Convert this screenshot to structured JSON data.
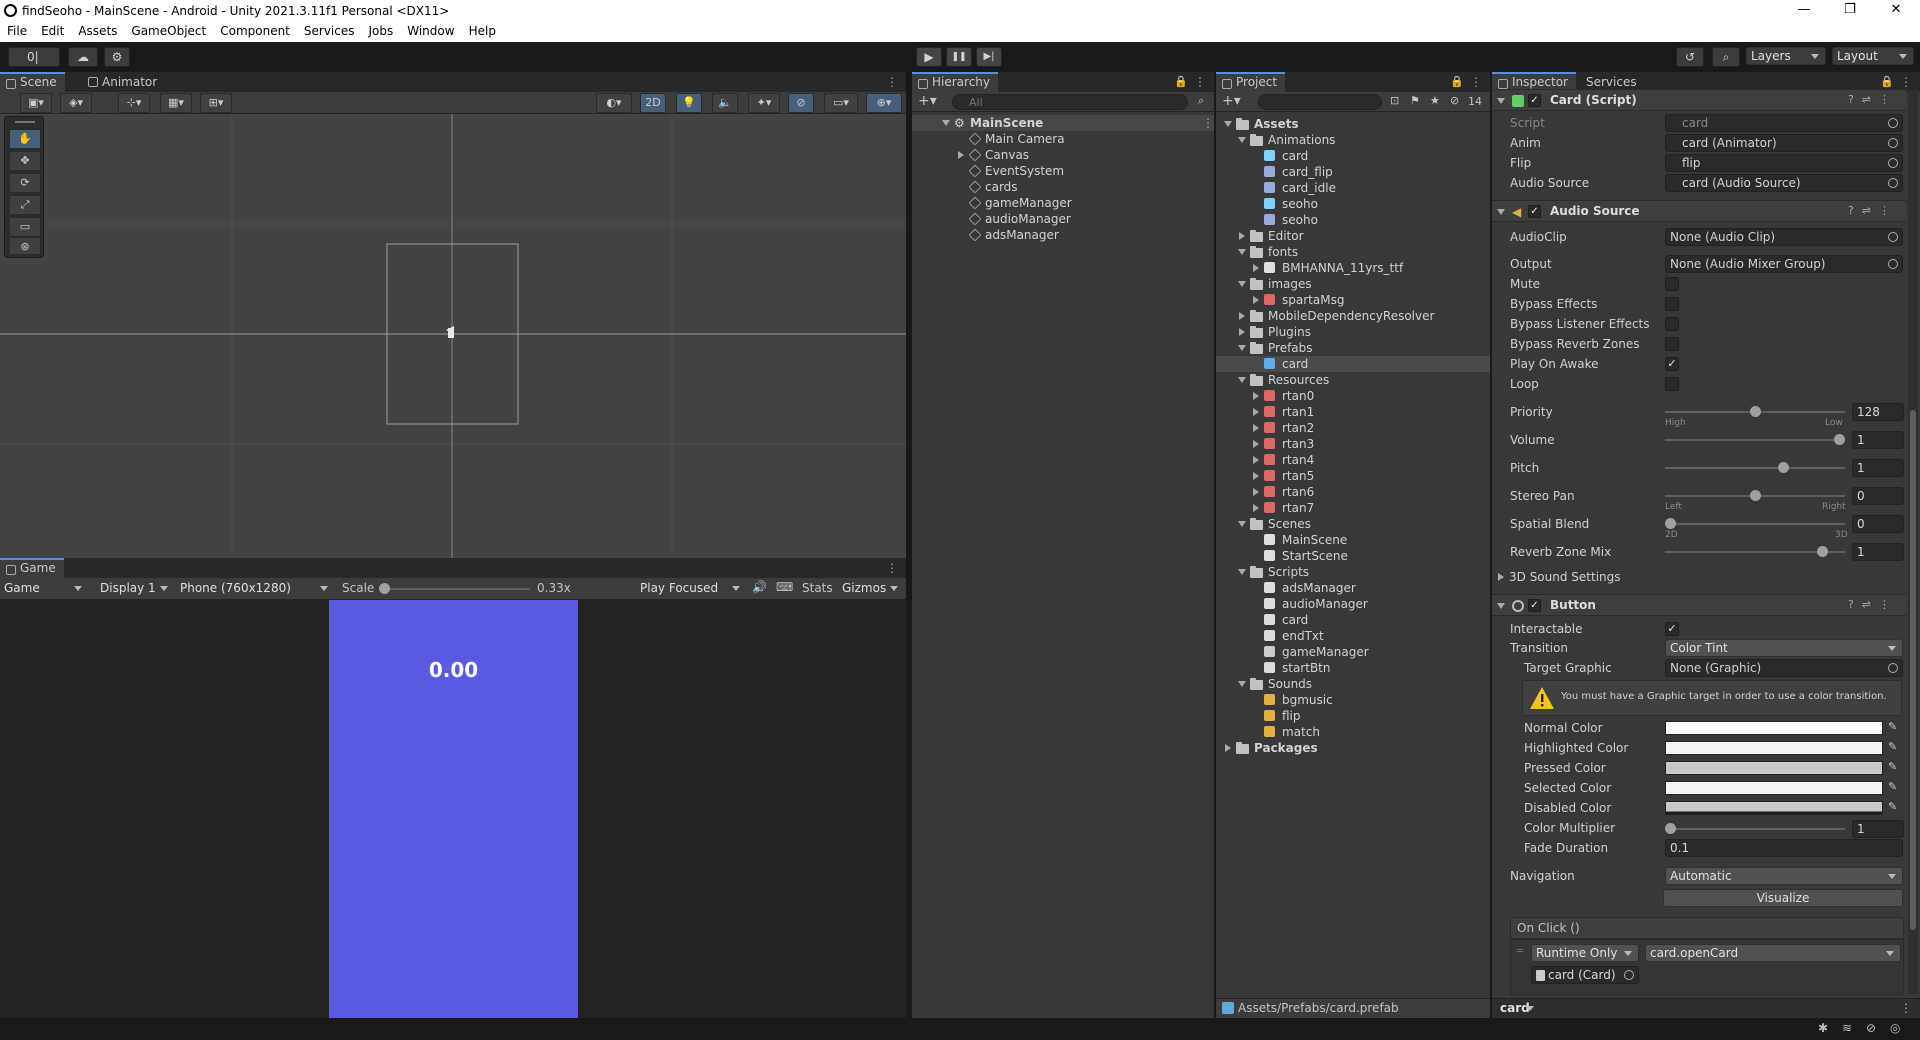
{
  "window": {
    "title": "findSeoho - MainScene - Android - Unity 2021.3.11f1 Personal <DX11>",
    "minimize": "—",
    "maximize": "❐",
    "close": "✕"
  },
  "menu": [
    "File",
    "Edit",
    "Assets",
    "GameObject",
    "Component",
    "Services",
    "Jobs",
    "Window",
    "Help"
  ],
  "toolbar": {
    "account_value": "0|",
    "play": "▶",
    "pause": "❚❚",
    "step": "▶|",
    "layers": "Layers",
    "layout": "Layout"
  },
  "scene": {
    "tab_scene": "Scene",
    "tab_animator": "Animator",
    "btn_2d": "2D"
  },
  "game": {
    "tab": "Game",
    "mode": "Game",
    "display": "Display 1",
    "resolution": "Phone (760x1280)",
    "scale_label": "Scale",
    "scale_value": "0.33x",
    "scale_fraction": 0.0,
    "play_focused": "Play Focused",
    "stats": "Stats",
    "gizmos": "Gizmos",
    "timer": "0.00",
    "bg_color": "#5a5ae0"
  },
  "hierarchy": {
    "tab": "Hierarchy",
    "search_placeholder": "All",
    "scene_name": "MainScene",
    "items": [
      "Main Camera",
      "Canvas",
      "EventSystem",
      "cards",
      "gameManager",
      "audioManager",
      "adsManager"
    ]
  },
  "project": {
    "tab": "Project",
    "hidden_count": "14",
    "rows": [
      {
        "label": "Assets",
        "icon": "folder",
        "depth": 0,
        "open": true,
        "bold": true
      },
      {
        "label": "Animations",
        "icon": "folder",
        "depth": 1,
        "open": true
      },
      {
        "label": "card",
        "icon": "animator-icon",
        "depth": 2
      },
      {
        "label": "card_flip",
        "icon": "anim-clip-icon",
        "depth": 2
      },
      {
        "label": "card_idle",
        "icon": "anim-clip-icon",
        "depth": 2
      },
      {
        "label": "seoho",
        "icon": "animator-icon",
        "depth": 2
      },
      {
        "label": "seoho",
        "icon": "anim-clip-icon",
        "depth": 2
      },
      {
        "label": "Editor",
        "icon": "folder",
        "depth": 1,
        "closed": true
      },
      {
        "label": "fonts",
        "icon": "folder",
        "depth": 1,
        "open": true
      },
      {
        "label": "BMHANNA_11yrs_ttf",
        "icon": "font-icon",
        "depth": 2,
        "closed": true
      },
      {
        "label": "images",
        "icon": "folder",
        "depth": 1,
        "open": true
      },
      {
        "label": "spartaMsg",
        "icon": "sprite-icon",
        "depth": 2,
        "closed": true
      },
      {
        "label": "MobileDependencyResolver",
        "icon": "folder",
        "depth": 1,
        "closed": true
      },
      {
        "label": "Plugins",
        "icon": "folder",
        "depth": 1,
        "closed": true
      },
      {
        "label": "Prefabs",
        "icon": "folder",
        "depth": 1,
        "open": true
      },
      {
        "label": "card",
        "icon": "prefab-icon",
        "depth": 2,
        "selected": true
      },
      {
        "label": "Resources",
        "icon": "folder",
        "depth": 1,
        "open": true
      },
      {
        "label": "rtan0",
        "icon": "sprite-icon",
        "depth": 2,
        "closed": true
      },
      {
        "label": "rtan1",
        "icon": "sprite-icon",
        "depth": 2,
        "closed": true
      },
      {
        "label": "rtan2",
        "icon": "sprite-icon",
        "depth": 2,
        "closed": true
      },
      {
        "label": "rtan3",
        "icon": "sprite-icon",
        "depth": 2,
        "closed": true
      },
      {
        "label": "rtan4",
        "icon": "sprite-icon",
        "depth": 2,
        "closed": true
      },
      {
        "label": "rtan5",
        "icon": "sprite-icon",
        "depth": 2,
        "closed": true
      },
      {
        "label": "rtan6",
        "icon": "sprite-icon",
        "depth": 2,
        "closed": true
      },
      {
        "label": "rtan7",
        "icon": "sprite-icon",
        "depth": 2,
        "closed": true
      },
      {
        "label": "Scenes",
        "icon": "folder",
        "depth": 1,
        "open": true
      },
      {
        "label": "MainScene",
        "icon": "scene-icon",
        "depth": 2
      },
      {
        "label": "StartScene",
        "icon": "scene-icon",
        "depth": 2
      },
      {
        "label": "Scripts",
        "icon": "folder",
        "depth": 1,
        "open": true
      },
      {
        "label": "adsManager",
        "icon": "script-icon",
        "depth": 2
      },
      {
        "label": "audioManager",
        "icon": "script-icon",
        "depth": 2
      },
      {
        "label": "card",
        "icon": "script-icon",
        "depth": 2
      },
      {
        "label": "endTxt",
        "icon": "script-icon",
        "depth": 2
      },
      {
        "label": "gameManager",
        "icon": "gear-icon",
        "depth": 2
      },
      {
        "label": "startBtn",
        "icon": "script-icon",
        "depth": 2
      },
      {
        "label": "Sounds",
        "icon": "folder",
        "depth": 1,
        "open": true
      },
      {
        "label": "bgmusic",
        "icon": "audio-icon",
        "depth": 2
      },
      {
        "label": "flip",
        "icon": "audio-icon",
        "depth": 2
      },
      {
        "label": "match",
        "icon": "audio-icon",
        "depth": 2
      },
      {
        "label": "Packages",
        "icon": "folder",
        "depth": 0,
        "closed": true,
        "bold": true
      }
    ],
    "footer_path": "Assets/Prefabs/card.prefab"
  },
  "inspector": {
    "tab_inspector": "Inspector",
    "tab_services": "Services",
    "card_script": {
      "title": "Card (Script)",
      "script_label": "Script",
      "script_value": "card",
      "anim_label": "Anim",
      "anim_value": "card (Animator)",
      "flip_label": "Flip",
      "flip_value": "flip",
      "audio_label": "Audio Source",
      "audio_value": "card (Audio Source)"
    },
    "audio_source": {
      "title": "Audio Source",
      "clip_label": "AudioClip",
      "clip_value": "None (Audio Clip)",
      "output_label": "Output",
      "output_value": "None (Audio Mixer Group)",
      "mute": "Mute",
      "bypass_effects": "Bypass Effects",
      "bypass_listener": "Bypass Listener Effects",
      "bypass_reverb": "Bypass Reverb Zones",
      "play_on_awake": "Play On Awake",
      "loop": "Loop",
      "priority_label": "Priority",
      "priority_value": "128",
      "priority_fraction": 0.5,
      "priority_high": "High",
      "priority_low": "Low",
      "volume_label": "Volume",
      "volume_value": "1",
      "volume_fraction": 1.0,
      "pitch_label": "Pitch",
      "pitch_value": "1",
      "pitch_fraction": 0.67,
      "stereo_label": "Stereo Pan",
      "stereo_value": "0",
      "stereo_fraction": 0.5,
      "stereo_left": "Left",
      "stereo_right": "Right",
      "spatial_label": "Spatial Blend",
      "spatial_value": "0",
      "spatial_fraction": 0.0,
      "spatial_2d": "2D",
      "spatial_3d": "3D",
      "reverb_label": "Reverb Zone Mix",
      "reverb_value": "1",
      "reverb_fraction": 0.9,
      "sound3d": "3D Sound Settings"
    },
    "button": {
      "title": "Button",
      "interactable": "Interactable",
      "transition_label": "Transition",
      "transition_value": "Color Tint",
      "target_label": "Target Graphic",
      "target_value": "None (Graphic)",
      "warning": "You must have a Graphic target in order to use a color transition.",
      "normal": "Normal Color",
      "highlighted": "Highlighted Color",
      "pressed": "Pressed Color",
      "selected": "Selected Color",
      "disabled": "Disabled Color",
      "multiplier_label": "Color Multiplier",
      "multiplier_value": "1",
      "multiplier_fraction": 0.0,
      "fade_label": "Fade Duration",
      "fade_value": "0.1",
      "nav_label": "Navigation",
      "nav_value": "Automatic",
      "visualize": "Visualize",
      "onclick": "On Click ()",
      "runtime": "Runtime Only",
      "method": "card.openCard",
      "object": "card (Card)"
    },
    "footer": "card"
  }
}
